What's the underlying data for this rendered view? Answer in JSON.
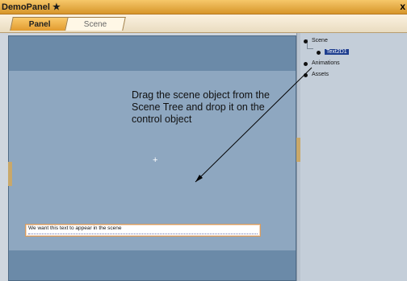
{
  "window": {
    "title": "DemoPanel",
    "close_label": "x"
  },
  "tabs": [
    {
      "label": "Panel",
      "active": true
    },
    {
      "label": "Scene",
      "active": false
    }
  ],
  "scene": {
    "instruction": "Drag the scene object from the Scene Tree and drop it on the control object",
    "text_control_value": "We want this text to appear in the scene"
  },
  "tree": {
    "items": [
      {
        "label": "Scene"
      },
      {
        "label": "Text2D1"
      },
      {
        "label": "Animations"
      },
      {
        "label": "Assets"
      }
    ]
  },
  "colors": {
    "title_bar": "#e8a640",
    "tab_active": "#f0b04d",
    "scene_bg": "#8ea7c0",
    "scene_border": "#6b8aa8",
    "tree_bg": "#c4ced9",
    "selection": "#1f3f8f"
  },
  "icons": {
    "window_icon": "pin-icon",
    "close": "close-icon",
    "crosshair": "plus-icon",
    "arrow": "arrow-icon"
  }
}
